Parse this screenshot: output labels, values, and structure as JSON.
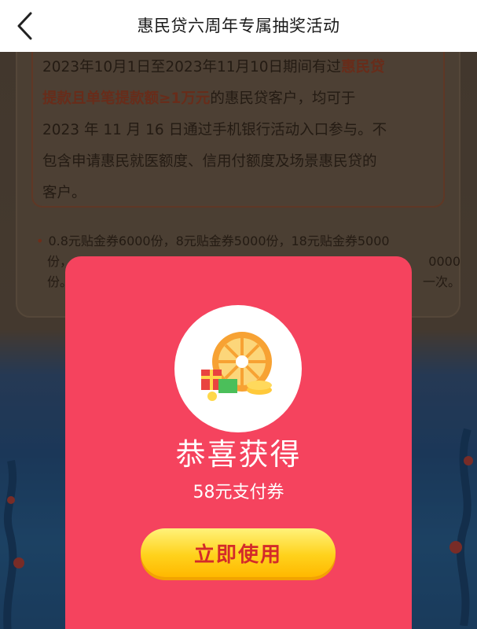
{
  "header": {
    "title": "惠民贷六周年专属抽奖活动",
    "back_icon": "chevron-left-icon"
  },
  "rules": {
    "lines": [
      {
        "parts": [
          {
            "text": "2023年10月1日至2023年11月10日期间有过",
            "hl": false
          },
          {
            "text": "惠民贷",
            "hl": true
          }
        ]
      },
      {
        "parts": [
          {
            "text": "提款且单笔提款额≥1万元",
            "hl": true
          },
          {
            "text": "的惠民贷客户，均可于",
            "hl": false
          }
        ]
      },
      {
        "parts": [
          {
            "text": "2023 年 11 月 16 日通过手机银行活动入口参与。不",
            "hl": false
          }
        ]
      },
      {
        "parts": [
          {
            "text": "包含申请惠民就医额度、信用付额度及场景惠民贷的",
            "hl": false
          }
        ]
      },
      {
        "parts": [
          {
            "text": "客户。",
            "hl": false
          }
        ]
      }
    ],
    "bullet_line1": "0.8元贴金券6000份，8元贴金券5000份，18元贴金券5000",
    "bullet_line2": "份，",
    "bullet_line2_end": "0000",
    "bullet_line3": "份。",
    "bullet_line3_end": "一次。"
  },
  "modal": {
    "prize_icon": "prize-wheel-gift-icon",
    "title": "恭喜获得",
    "prize": "58元支付券",
    "button_label": "立即使用",
    "colors": {
      "background": "#f5435e",
      "button": "#ffd21c",
      "button_text": "#d32a2a"
    }
  }
}
